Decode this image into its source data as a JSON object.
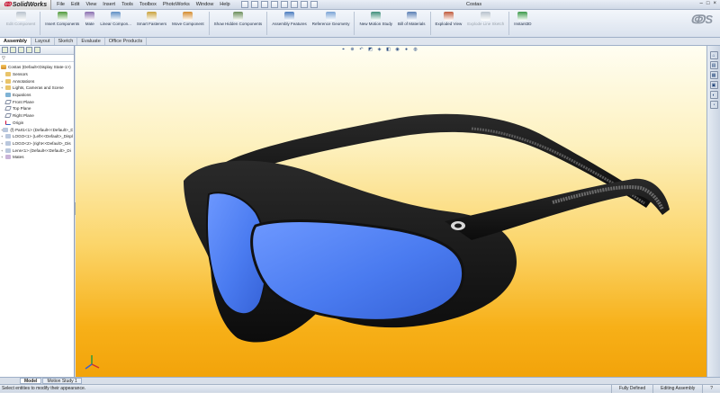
{
  "app": {
    "name": "SolidWorks",
    "document_title": "Costas"
  },
  "menu": [
    "File",
    "Edit",
    "View",
    "Insert",
    "Tools",
    "Toolbox",
    "PhotoWorks",
    "Window",
    "Help"
  ],
  "ribbon": {
    "buttons": [
      {
        "label": "Edit Component",
        "icon": "edit-component-icon",
        "enabled": false,
        "color": "#b8c2cc"
      },
      {
        "label": "Insert Components",
        "icon": "insert-components-icon",
        "enabled": true,
        "color": "#4f9a3a"
      },
      {
        "label": "Mate",
        "icon": "mate-icon",
        "enabled": true,
        "color": "#8a6fb0"
      },
      {
        "label": "Linear Compon...",
        "icon": "linear-pattern-icon",
        "enabled": true,
        "color": "#5f8fc4"
      },
      {
        "label": "Smart Fasteners",
        "icon": "smart-fasteners-icon",
        "enabled": true,
        "color": "#c9a23d"
      },
      {
        "label": "Move Component",
        "icon": "move-component-icon",
        "enabled": true,
        "color": "#d48a2c"
      },
      {
        "label": "Show Hidden Components",
        "icon": "show-hidden-icon",
        "enabled": true,
        "color": "#6b8e5a"
      },
      {
        "label": "Assembly Features",
        "icon": "assembly-features-icon",
        "enabled": true,
        "color": "#4a7bbf"
      },
      {
        "label": "Reference Geometry",
        "icon": "reference-geometry-icon",
        "enabled": true,
        "color": "#7aa3d6"
      },
      {
        "label": "New Motion Study",
        "icon": "motion-study-icon",
        "enabled": true,
        "color": "#3f8f7a"
      },
      {
        "label": "Bill of Materials",
        "icon": "bill-of-materials-icon",
        "enabled": true,
        "color": "#5a7fb5"
      },
      {
        "label": "Exploded View",
        "icon": "exploded-view-icon",
        "enabled": true,
        "color": "#c05a3c"
      },
      {
        "label": "Explode Line Sketch",
        "icon": "explode-line-sketch-icon",
        "enabled": false,
        "color": "#b8c2cc"
      },
      {
        "label": "Instant3D",
        "icon": "instant3d-icon",
        "enabled": true,
        "color": "#3c9a4a"
      }
    ]
  },
  "tabs": [
    "Assembly",
    "Layout",
    "Sketch",
    "Evaluate",
    "Office Products"
  ],
  "active_tab": "Assembly",
  "feature_tree": {
    "root": "Costas (Default<Display State-1>)",
    "items": [
      {
        "label": "Sensors",
        "icon": "folder",
        "expand": ""
      },
      {
        "label": "Annotations",
        "icon": "folder",
        "expand": "+"
      },
      {
        "label": "Lights, Cameras and Scene",
        "icon": "folder",
        "expand": "+"
      },
      {
        "label": "Equations",
        "icon": "eq",
        "expand": ""
      },
      {
        "label": "Front Plane",
        "icon": "plane",
        "expand": ""
      },
      {
        "label": "Top Plane",
        "icon": "plane",
        "expand": ""
      },
      {
        "label": "Right Plane",
        "icon": "plane",
        "expand": ""
      },
      {
        "label": "Origin",
        "icon": "origin",
        "expand": ""
      },
      {
        "label": "(f) Part1<1> (Default<<Default>_Di",
        "icon": "part",
        "expand": "+"
      },
      {
        "label": "LOGO<1> (Left<<Default>_Displ",
        "icon": "part",
        "expand": "+"
      },
      {
        "label": "LOGO<2> (right<<Default>_Dis",
        "icon": "part",
        "expand": "+"
      },
      {
        "label": "Lens<1> (Default<<Default>_Di",
        "icon": "part",
        "expand": "+"
      },
      {
        "label": "Mates",
        "icon": "mate",
        "expand": "+"
      }
    ]
  },
  "bottom_tabs": [
    "Model",
    "Motion Study 1"
  ],
  "active_bottom_tab": "Model",
  "status": {
    "message": "Select entities to modify their appearance.",
    "state": "Fully Defined",
    "mode": "Editing Assembly",
    "help": "?"
  },
  "colors": {
    "frame": "#141414",
    "lens": "#4c7ff0",
    "background_top": "#fffef2",
    "background_bottom": "#f2a30a"
  }
}
